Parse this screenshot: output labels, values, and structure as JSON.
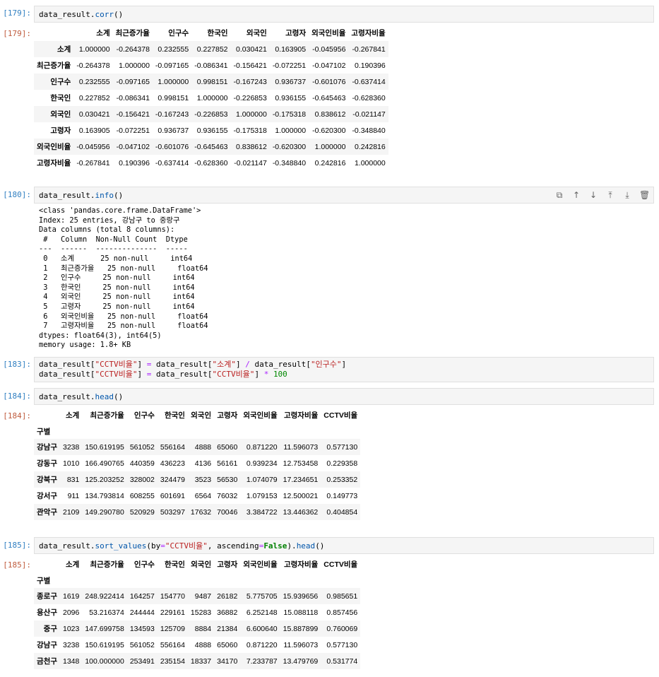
{
  "cells": {
    "c179": {
      "in_prompt": "[179]:",
      "out_prompt": "[179]:",
      "code_var": "data_result",
      "code_fn": "corr",
      "table": {
        "columns": [
          "소계",
          "최근증가율",
          "인구수",
          "한국인",
          "외국인",
          "고령자",
          "외국인비율",
          "고령자비율"
        ],
        "rows": [
          {
            "index": "소계",
            "values": [
              "1.000000",
              "-0.264378",
              "0.232555",
              "0.227852",
              "0.030421",
              "0.163905",
              "-0.045956",
              "-0.267841"
            ]
          },
          {
            "index": "최근증가율",
            "values": [
              "-0.264378",
              "1.000000",
              "-0.097165",
              "-0.086341",
              "-0.156421",
              "-0.072251",
              "-0.047102",
              "0.190396"
            ]
          },
          {
            "index": "인구수",
            "values": [
              "0.232555",
              "-0.097165",
              "1.000000",
              "0.998151",
              "-0.167243",
              "0.936737",
              "-0.601076",
              "-0.637414"
            ]
          },
          {
            "index": "한국인",
            "values": [
              "0.227852",
              "-0.086341",
              "0.998151",
              "1.000000",
              "-0.226853",
              "0.936155",
              "-0.645463",
              "-0.628360"
            ]
          },
          {
            "index": "외국인",
            "values": [
              "0.030421",
              "-0.156421",
              "-0.167243",
              "-0.226853",
              "1.000000",
              "-0.175318",
              "0.838612",
              "-0.021147"
            ]
          },
          {
            "index": "고령자",
            "values": [
              "0.163905",
              "-0.072251",
              "0.936737",
              "0.936155",
              "-0.175318",
              "1.000000",
              "-0.620300",
              "-0.348840"
            ]
          },
          {
            "index": "외국인비율",
            "values": [
              "-0.045956",
              "-0.047102",
              "-0.601076",
              "-0.645463",
              "0.838612",
              "-0.620300",
              "1.000000",
              "0.242816"
            ]
          },
          {
            "index": "고령자비율",
            "values": [
              "-0.267841",
              "0.190396",
              "-0.637414",
              "-0.628360",
              "-0.021147",
              "-0.348840",
              "0.242816",
              "1.000000"
            ]
          }
        ]
      }
    },
    "c180": {
      "in_prompt": "[180]:",
      "code_var": "data_result",
      "code_fn": "info",
      "output": "<class 'pandas.core.frame.DataFrame'>\nIndex: 25 entries, 강남구 to 중랑구\nData columns (total 8 columns):\n #   Column  Non-Null Count  Dtype\n---  ------  --------------  -----\n 0   소계      25 non-null     int64\n 1   최근증가율   25 non-null     float64\n 2   인구수     25 non-null     int64\n 3   한국인     25 non-null     int64\n 4   외국인     25 non-null     int64\n 5   고령자     25 non-null     int64\n 6   외국인비율   25 non-null     float64\n 7   고령자비율   25 non-null     float64\ndtypes: float64(3), int64(5)\nmemory usage: 1.8+ KB"
    },
    "c183": {
      "in_prompt": "[183]:",
      "line1": {
        "var": "data_result",
        "key1": "\"CCTV비율\"",
        "eq": "=",
        "var2": "data_result",
        "key2": "\"소계\"",
        "op": "/",
        "var3": "data_result",
        "key3": "\"인구수\""
      },
      "line2": {
        "var": "data_result",
        "key1": "\"CCTV비율\"",
        "eq": "=",
        "var2": "data_result",
        "key2": "\"CCTV비율\"",
        "op": "*",
        "num": "100"
      }
    },
    "c184": {
      "in_prompt": "[184]:",
      "out_prompt": "[184]:",
      "code_var": "data_result",
      "code_fn": "head",
      "table": {
        "index_name": "구별",
        "columns": [
          "소계",
          "최근증가율",
          "인구수",
          "한국인",
          "외국인",
          "고령자",
          "외국인비율",
          "고령자비율",
          "CCTV비율"
        ],
        "rows": [
          {
            "index": "강남구",
            "values": [
              "3238",
              "150.619195",
              "561052",
              "556164",
              "4888",
              "65060",
              "0.871220",
              "11.596073",
              "0.577130"
            ]
          },
          {
            "index": "강동구",
            "values": [
              "1010",
              "166.490765",
              "440359",
              "436223",
              "4136",
              "56161",
              "0.939234",
              "12.753458",
              "0.229358"
            ]
          },
          {
            "index": "강북구",
            "values": [
              "831",
              "125.203252",
              "328002",
              "324479",
              "3523",
              "56530",
              "1.074079",
              "17.234651",
              "0.253352"
            ]
          },
          {
            "index": "강서구",
            "values": [
              "911",
              "134.793814",
              "608255",
              "601691",
              "6564",
              "76032",
              "1.079153",
              "12.500021",
              "0.149773"
            ]
          },
          {
            "index": "관악구",
            "values": [
              "2109",
              "149.290780",
              "520929",
              "503297",
              "17632",
              "70046",
              "3.384722",
              "13.446362",
              "0.404854"
            ]
          }
        ]
      }
    },
    "c185": {
      "in_prompt": "[185]:",
      "out_prompt": "[185]:",
      "code": {
        "var": "data_result",
        "fn": "sort_values",
        "arg_by": "by",
        "arg_by_val": "\"CCTV비율\"",
        "arg_asc": "ascending",
        "arg_asc_val": "False",
        "fn2": "head"
      },
      "table": {
        "index_name": "구별",
        "columns": [
          "소계",
          "최근증가율",
          "인구수",
          "한국인",
          "외국인",
          "고령자",
          "외국인비율",
          "고령자비율",
          "CCTV비율"
        ],
        "rows": [
          {
            "index": "종로구",
            "values": [
              "1619",
              "248.922414",
              "164257",
              "154770",
              "9487",
              "26182",
              "5.775705",
              "15.939656",
              "0.985651"
            ]
          },
          {
            "index": "용산구",
            "values": [
              "2096",
              "53.216374",
              "244444",
              "229161",
              "15283",
              "36882",
              "6.252148",
              "15.088118",
              "0.857456"
            ]
          },
          {
            "index": "중구",
            "values": [
              "1023",
              "147.699758",
              "134593",
              "125709",
              "8884",
              "21384",
              "6.600640",
              "15.887899",
              "0.760069"
            ]
          },
          {
            "index": "강남구",
            "values": [
              "3238",
              "150.619195",
              "561052",
              "556164",
              "4888",
              "65060",
              "0.871220",
              "11.596073",
              "0.577130"
            ]
          },
          {
            "index": "금천구",
            "values": [
              "1348",
              "100.000000",
              "253491",
              "235154",
              "18337",
              "34170",
              "7.233787",
              "13.479769",
              "0.531774"
            ]
          }
        ]
      }
    }
  },
  "toolbar": {
    "icons": [
      "copy-icon",
      "move-up-icon",
      "move-down-icon",
      "insert-above-icon",
      "insert-below-icon",
      "delete-icon"
    ],
    "glyphs": [
      "⧉",
      "↑",
      "↓",
      "⤒",
      "⤓",
      "🗑"
    ]
  }
}
